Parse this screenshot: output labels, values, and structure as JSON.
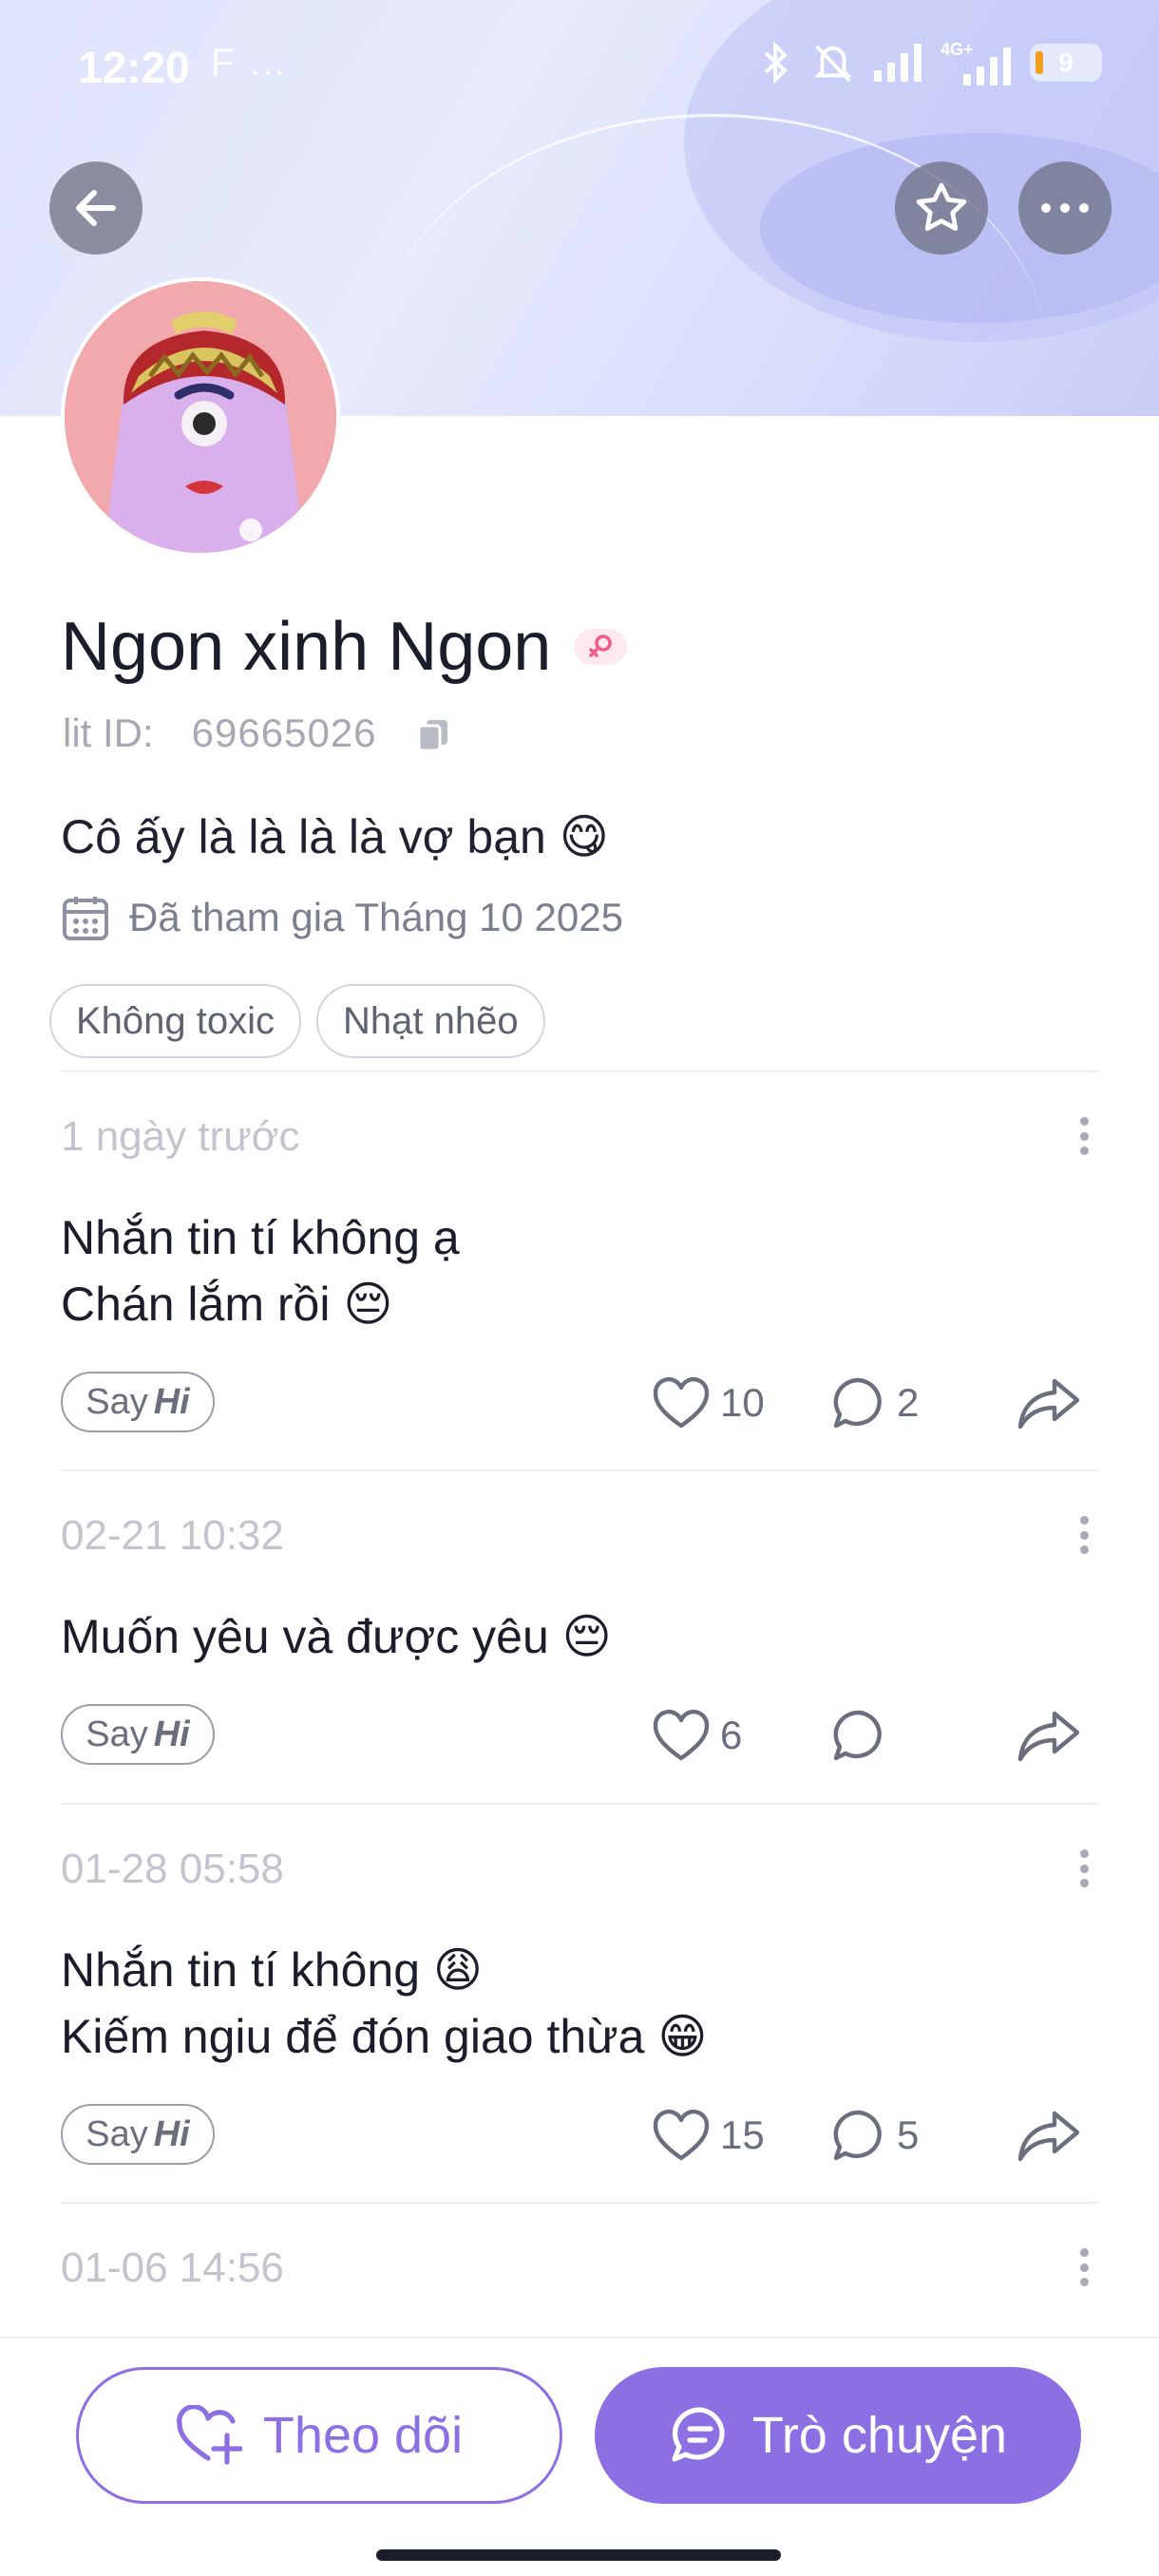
{
  "status_bar": {
    "time": "12:20",
    "extra": "F …",
    "battery": "9",
    "icons": [
      "bluetooth-icon",
      "mute-icon",
      "signal-icon",
      "4g-signal-icon",
      "battery-icon"
    ]
  },
  "profile": {
    "name": "Ngon xinh Ngon",
    "gender": "female",
    "id_label": "lit ID:",
    "id_value": "69665026",
    "bio": "Cô ấy là là là là vợ bạn 😋",
    "joined": "Đã tham gia Tháng 10 2025",
    "tags": [
      "Không toxic",
      "Nhạt nhẽo"
    ]
  },
  "posts": [
    {
      "time": "1 ngày trước",
      "lines": [
        "Nhắn tin tí không ạ",
        "Chán lắm rồi 😔"
      ],
      "likes": "10",
      "comments": "2"
    },
    {
      "time": "02-21 10:32",
      "lines": [
        "Muốn yêu và được yêu 😔"
      ],
      "likes": "6",
      "comments": ""
    },
    {
      "time": "01-28 05:58",
      "lines": [
        "Nhắn tin tí không 😩",
        "Kiếm ngiu để đón giao thừa 😁"
      ],
      "likes": "15",
      "comments": "5"
    },
    {
      "time": "01-06 14:56",
      "lines": [],
      "likes": "",
      "comments": ""
    }
  ],
  "sayhi": {
    "say": "Say",
    "hi": "Hi"
  },
  "actions": {
    "follow": "Theo dõi",
    "chat": "Trò chuyện"
  },
  "colors": {
    "accent": "#8b6fe3",
    "header_bg": "#dfe3fb",
    "muted_text": "#a6a8b4"
  }
}
